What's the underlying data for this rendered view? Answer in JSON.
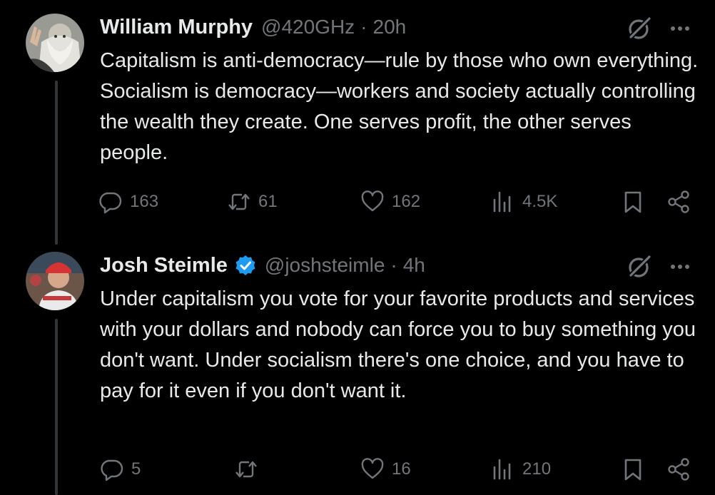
{
  "tweets": [
    {
      "name": "William Murphy",
      "handle": "@420GHz",
      "separator": "·",
      "time": "20h",
      "verified": false,
      "text": "Capitalism is anti-democracy—rule by those who own everything. Socialism is democracy—workers and society actually controlling the wealth they create. One serves profit, the other serves people.",
      "replies": "163",
      "reposts": "61",
      "likes": "162",
      "views": "4.5K"
    },
    {
      "name": "Josh Steimle",
      "handle": "@joshsteimle",
      "separator": "·",
      "time": "4h",
      "verified": true,
      "text": "Under capitalism you vote for your favorite products and services with your dollars and nobody can force you to buy something you don't want. Under socialism there's one choice, and you have to pay for it even if you don't want it.",
      "replies": "5",
      "reposts": "",
      "likes": "16",
      "views": "210"
    }
  ],
  "colors": {
    "background": "#000000",
    "primary_text": "#e7e9ea",
    "secondary_text": "#71767b",
    "verified_blue": "#1d9bf0",
    "thread_line": "#333639"
  },
  "icons": {
    "reply": "reply-icon",
    "repost": "repost-icon",
    "like": "like-icon",
    "views": "views-icon",
    "bookmark": "bookmark-icon",
    "share": "share-icon",
    "grok": "grok-icon",
    "more": "more-icon",
    "verified": "verified-badge-icon"
  }
}
